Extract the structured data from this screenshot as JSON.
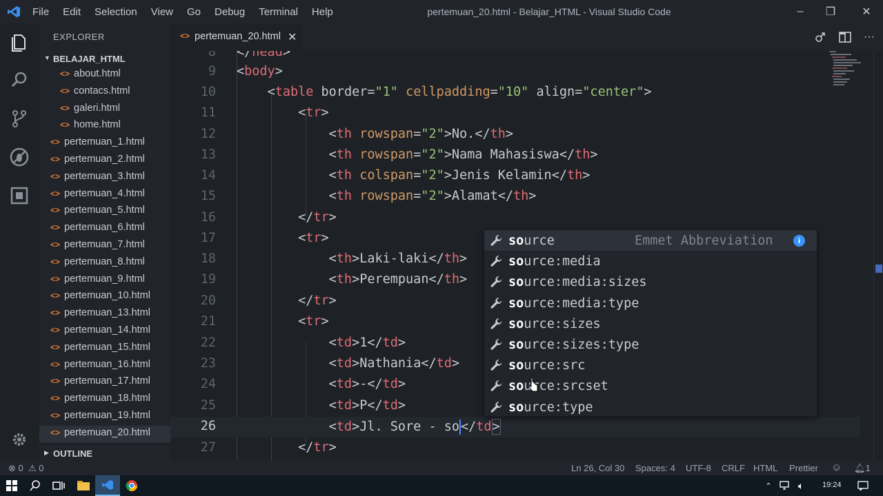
{
  "menu": [
    "File",
    "Edit",
    "Selection",
    "View",
    "Go",
    "Debug",
    "Terminal",
    "Help"
  ],
  "window_title": "pertemuan_20.html - Belajar_HTML - Visual Studio Code",
  "window_controls": {
    "minimize": "–",
    "restore": "❐",
    "close": "✕"
  },
  "explorer": {
    "title": "EXPLORER",
    "folder": "BELAJAR_HTML",
    "subfolder_files": [
      "about.html",
      "contacs.html",
      "galeri.html",
      "home.html"
    ],
    "files": [
      "pertemuan_1.html",
      "pertemuan_2.html",
      "pertemuan_3.html",
      "pertemuan_4.html",
      "pertemuan_5.html",
      "pertemuan_6.html",
      "pertemuan_7.html",
      "pertemuan_8.html",
      "pertemuan_9.html",
      "pertemuan_10.html",
      "pertemuan_13.html",
      "pertemuan_14.html",
      "pertemuan_15.html",
      "pertemuan_16.html",
      "pertemuan_17.html",
      "pertemuan_18.html",
      "pertemuan_19.html",
      "pertemuan_20.html"
    ],
    "active_file": "pertemuan_20.html",
    "outline": "OUTLINE"
  },
  "tab": {
    "name": "pertemuan_20.html",
    "icon": "<>",
    "close": "✕"
  },
  "line_numbers": [
    "8",
    "9",
    "10",
    "11",
    "12",
    "13",
    "14",
    "15",
    "16",
    "17",
    "18",
    "19",
    "20",
    "21",
    "22",
    "23",
    "24",
    "25",
    "26",
    "27"
  ],
  "code": {
    "l8": "</head>",
    "l9": "<body>",
    "l10_tag": "table",
    "l10_a1": "border",
    "l10_v1": "\"1\"",
    "l10_a2": "cellpadding",
    "l10_v2": "\"10\"",
    "l10_a3": "align",
    "l10_v3": "\"center\"",
    "l11": "tr",
    "th_rows": [
      {
        "attr": "rowspan",
        "val": "\"2\"",
        "text": "No."
      },
      {
        "attr": "rowspan",
        "val": "\"2\"",
        "text": "Nama Mahasiswa"
      },
      {
        "attr": "colspan",
        "val": "\"2\"",
        "text": "Jenis Kelamin"
      },
      {
        "attr": "rowspan",
        "val": "\"2\"",
        "text": "Alamat"
      }
    ],
    "th_tag": "th",
    "td_tag": "td",
    "l18_text": "Laki-laki",
    "l19_text": "Perempuan",
    "td_rows": [
      "1",
      "Nathania",
      "-",
      "P"
    ],
    "l26_text": "Jl. Sore - so"
  },
  "suggestions": [
    {
      "match": "so",
      "rest": "urce",
      "detail": "Emmet Abbreviation",
      "info": "i"
    },
    {
      "match": "so",
      "rest": "urce:media"
    },
    {
      "match": "so",
      "rest": "urce:media:sizes"
    },
    {
      "match": "so",
      "rest": "urce:media:type"
    },
    {
      "match": "so",
      "rest": "urce:sizes"
    },
    {
      "match": "so",
      "rest": "urce:sizes:type"
    },
    {
      "match": "so",
      "rest": "urce:src"
    },
    {
      "match": "so",
      "rest": "urce:srcset"
    },
    {
      "match": "so",
      "rest": "urce:type"
    }
  ],
  "status": {
    "errors": "0",
    "warnings": "0",
    "position": "Ln 26, Col 30",
    "spaces": "Spaces: 4",
    "encoding": "UTF-8",
    "eol": "CRLF",
    "language": "HTML",
    "formatter": "Prettier",
    "notifications": "1"
  },
  "taskbar": {
    "time": "19:24"
  },
  "colors": {
    "tag": "#e06c75",
    "attr": "#d19a66",
    "string": "#98c379",
    "html_icon": "#e37933",
    "accent": "#528bff"
  }
}
